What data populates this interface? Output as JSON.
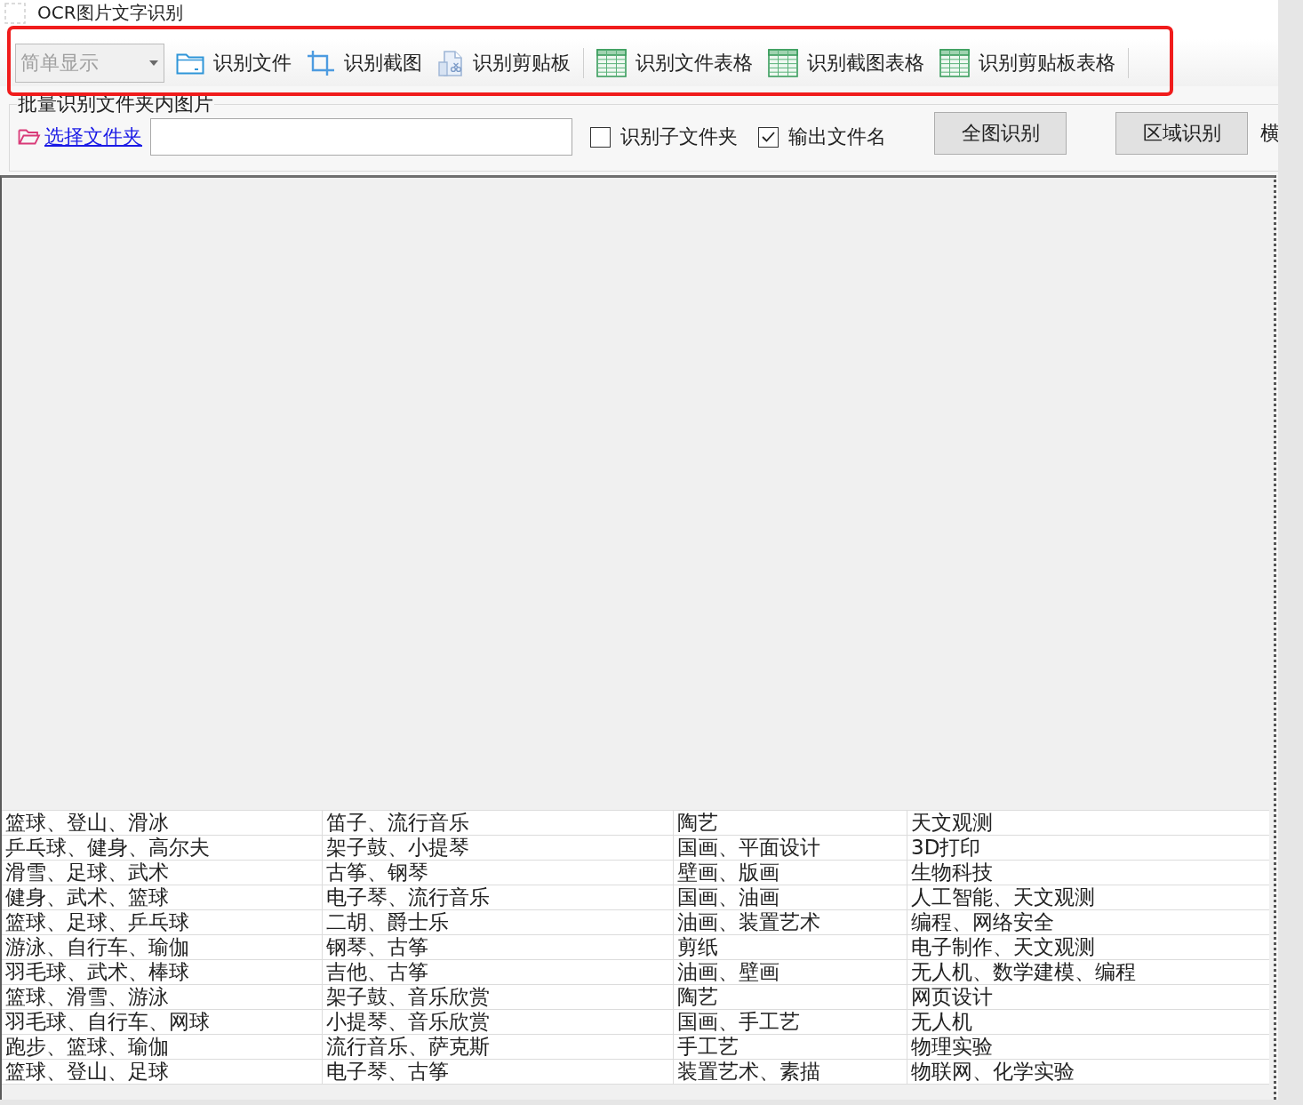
{
  "window": {
    "title": "OCR图片文字识别"
  },
  "toolbar": {
    "display_mode": {
      "value": "简单显示",
      "disabled": true
    },
    "groups": [
      {
        "buttons": [
          {
            "label": "识别文件",
            "kind": "folder"
          },
          {
            "label": "识别截图",
            "kind": "crop"
          },
          {
            "label": "识别剪贴板",
            "kind": "clipboard"
          }
        ]
      },
      {
        "buttons": [
          {
            "label": "识别文件表格",
            "kind": "table"
          },
          {
            "label": "识别截图表格",
            "kind": "table"
          },
          {
            "label": "识别剪贴板表格",
            "kind": "table"
          }
        ]
      }
    ]
  },
  "batch": {
    "title": "批量识别文件夹内图片",
    "folder_link": "选择文件夹",
    "options": [
      {
        "label": "识别子文件夹",
        "checked": false
      },
      {
        "label": "输出文件名",
        "checked": true
      }
    ],
    "actions": [
      "全图识别",
      "区域识别"
    ],
    "cut_label": "横"
  },
  "table": {
    "rows": [
      [
        "篮球、登山、滑冰",
        "笛子、流行音乐",
        "陶艺",
        "天文观测"
      ],
      [
        "乒乓球、健身、高尔夫",
        "架子鼓、小提琴",
        "国画、平面设计",
        "3D打印"
      ],
      [
        "滑雪、足球、武术",
        "古筝、钢琴",
        "壁画、版画",
        "生物科技"
      ],
      [
        "健身、武术、篮球",
        "电子琴、流行音乐",
        "国画、油画",
        "人工智能、天文观测"
      ],
      [
        "篮球、足球、乒乓球",
        "二胡、爵士乐",
        "油画、装置艺术",
        "编程、网络安全"
      ],
      [
        "游泳、自行车、瑜伽",
        "钢琴、古筝",
        "剪纸",
        "电子制作、天文观测"
      ],
      [
        "羽毛球、武术、棒球",
        "吉他、古筝",
        "油画、壁画",
        "无人机、数学建模、编程"
      ],
      [
        "篮球、滑雪、游泳",
        "架子鼓、音乐欣赏",
        "陶艺",
        "网页设计"
      ],
      [
        "羽毛球、自行车、网球",
        "小提琴、音乐欣赏",
        "国画、手工艺",
        "无人机"
      ],
      [
        "跑步、篮球、瑜伽",
        "流行音乐、萨克斯",
        "手工艺",
        "物理实验"
      ],
      [
        "篮球、登山、足球",
        "电子琴、古筝",
        "装置艺术、素描",
        "物联网、化学实验"
      ]
    ]
  }
}
